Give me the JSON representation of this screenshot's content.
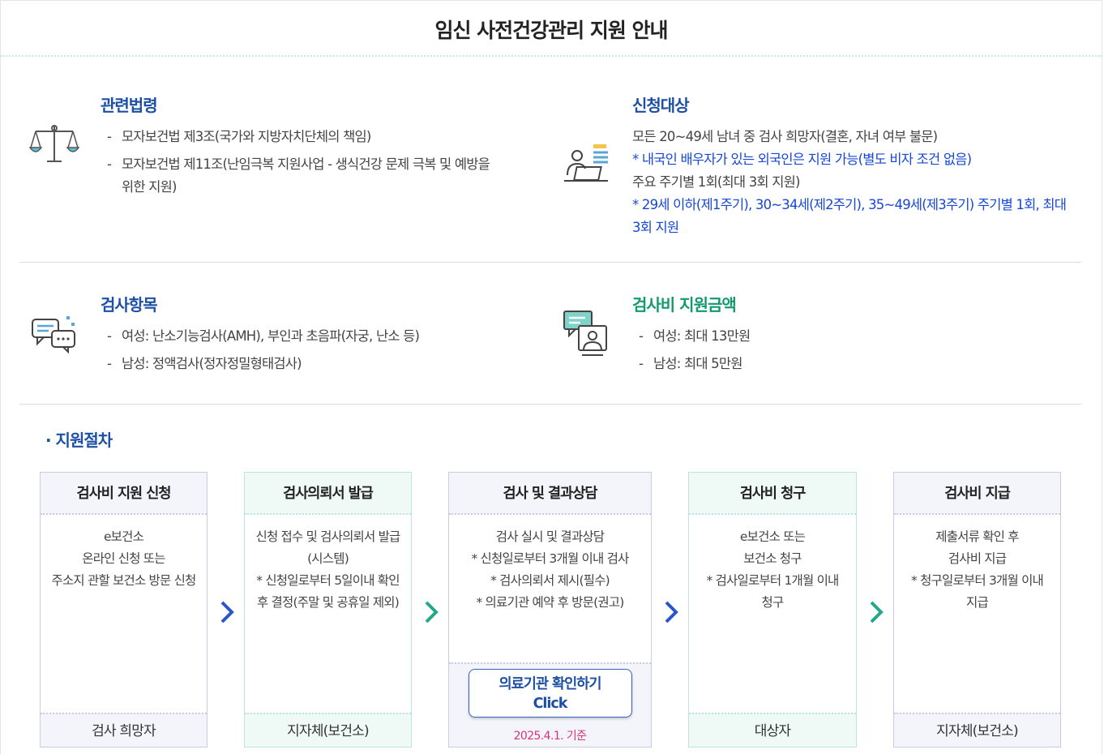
{
  "page_title": "임신 사전건강관리 지원 안내",
  "sections": {
    "law": {
      "title": "관련법령",
      "items": [
        "모자보건법 제3조(국가와 지방자치단체의 책임)",
        "모자보건법 제11조(난임극복 지원사업 - 생식건강 문제 극복 및 예방을",
        "위한 지원)"
      ]
    },
    "target": {
      "title": "신청대상",
      "line1": "모든 20~49세 남녀 중 검사 희망자(결혼, 자녀 여부 불문)",
      "note1": "* 내국인 배우자가 있는 외국인은 지원 가능(별도 비자 조건 없음)",
      "line2": "주요 주기별 1회(최대 3회 지원)",
      "note2a": "* 29세 이하(제1주기), 30~34세(제2주기), 35~49세(제3주기) 주기별 1회, 최대",
      "note2b": "3회 지원"
    },
    "tests": {
      "title": "검사항목",
      "items": [
        "여성: 난소기능검사(AMH), 부인과 초음파(자궁, 난소 등)",
        "남성: 정액검사(정자정밀형태검사)"
      ]
    },
    "amount": {
      "title": "검사비 지원금액",
      "items": [
        "여성: 최대 13만원",
        "남성: 최대 5만원"
      ]
    }
  },
  "procedure": {
    "title": "· 지원절차",
    "steps": [
      {
        "title": "검사비 지원 신청",
        "lines": [
          "e보건소",
          "온라인 신청 또는",
          "주소지 관할 보건소 방문 신청"
        ],
        "footer": "검사 희망자"
      },
      {
        "title": "검사의뢰서 발급",
        "lines": [
          "신청 접수 및 검사의뢰서 발급",
          "(시스템)",
          "* 신청일로부터 5일이내 확인",
          "후 결정(주말 및 공휴일 제외)"
        ],
        "footer": "지자체(보건소)"
      },
      {
        "title": "검사 및 결과상담",
        "lines": [
          "검사 실시 및 결과상담",
          "* 신청일로부터 3개월 이내 검사",
          "* 검사의뢰서 제시(필수)",
          "* 의료기관 예약 후 방문(권고)"
        ],
        "button_line1": "의료기관 확인하기",
        "button_line2": "Click",
        "date": "2025.4.1. 기준"
      },
      {
        "title": "검사비 청구",
        "lines": [
          "e보건소 또는",
          "보건소 청구",
          "* 검사일로부터 1개월 이내",
          "청구"
        ],
        "footer": "대상자"
      },
      {
        "title": "검사비 지급",
        "lines": [
          "제출서류 확인 후",
          "검사비 지급",
          "* 청구일로부터 3개월 이내",
          "지급"
        ],
        "footer": "지자체(보건소)"
      }
    ]
  },
  "colors": {
    "primary_blue": "#1d4fa5",
    "note_blue": "#1747d6",
    "green": "#139a6c",
    "pink": "#d6337a",
    "arrow_blue": "#2a56c6",
    "arrow_green": "#22a98a"
  },
  "dash": "-"
}
